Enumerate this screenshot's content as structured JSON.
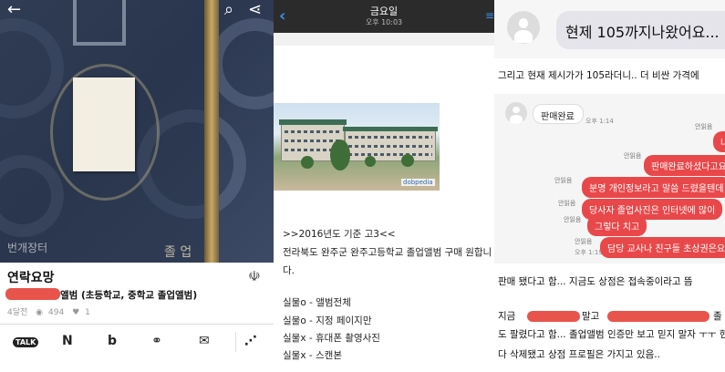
{
  "listing": {
    "watermark": "번개장터",
    "cover_text": "졸 업",
    "title": "연락요망",
    "subtitle": "앨범 (초등학교, 중학교 졸업앨범)",
    "stats": {
      "time": "4달전",
      "views": "494",
      "likes": "1"
    },
    "share": {
      "talk": "TALK",
      "naver": "N",
      "band": "b",
      "link": "⚭",
      "mail": "✉",
      "share": "⋰"
    },
    "icons": {
      "back": "←",
      "search": "⌕",
      "share_top": "⋖",
      "listing_icon": "☫"
    }
  },
  "chat": {
    "header_title": "금요일",
    "header_time": "오후 10:03",
    "image_logo": "dobpedia",
    "lines": [
      ">>2016년도 기준 고3<<",
      "전라북도 완주군 완주고등학교 졸업앨범 구매 원합니",
      "다.",
      "실물o - 앨범전체",
      "실물o - 지정 페이지만",
      "실물x - 휴대폰 촬영사진",
      "실물x - 스캔본"
    ]
  },
  "messages": {
    "big_bubble": "현제 105까지나왔어요...",
    "line1": "그리고 현재 제시가가 105라더니.. 더 비싼 가격에",
    "sold_bubble": "판매완료",
    "sold_time": "오후 1:14",
    "read_label": "안읽음",
    "red_bubbles": [
      "나",
      "판매완료하셨다고요",
      "분명 개인정보라고 말씀 드렸을텐데",
      "당사자 졸업사진은 인터넷에 많이",
      "그렇다 치고",
      "담당 교사나 친구들 초상권은요"
    ],
    "last_time": "오후 1:19",
    "bottom_lines": [
      "판매 됐다고 함... 지금도 상점은 접속중이라고 뜸",
      "지금",
      "말고",
      "졸",
      "도 팔렸다고 함... 졸업앨범 인증만 보고 믿지 말자 ㅜㅜ 현",
      "다 삭제됐고 상점 프로필은 가지고 있음.."
    ]
  }
}
